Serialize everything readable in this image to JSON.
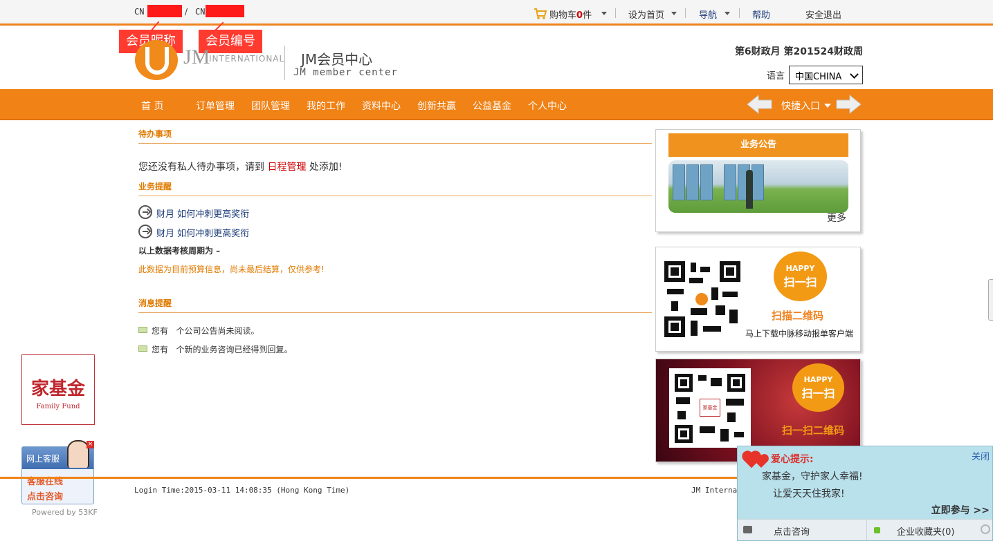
{
  "topbar": {
    "cn_prefix_1": "CN",
    "slash": "/",
    "cn_prefix_2": "CN",
    "cart_label": "购物车",
    "cart_count": "0",
    "cart_unit": "件",
    "set_home": "设为首页",
    "nav": "导航",
    "help": "帮助",
    "logout": "安全退出"
  },
  "annotations": {
    "nickname": "会员昵称",
    "member_no": "会员编号"
  },
  "header": {
    "brand_jm": "JM",
    "brand_intl": "INTERNATIONAL",
    "title": "JM会员中心",
    "subtitle": "JM member center",
    "fiscal": "第6财政月  第201524财政周",
    "lang_label": "语言",
    "lang_value": "中国CHINA"
  },
  "nav": {
    "items": [
      "首  页",
      "订单管理",
      "团队管理",
      "我的工作",
      "资料中心",
      "创新共赢",
      "公益基金",
      "个人中心"
    ],
    "quick": "快捷入口"
  },
  "todo": {
    "title": "待办事项",
    "text_before": "您还没有私人待办事项，请到 ",
    "link": "日程管理",
    "text_after": " 处添加!"
  },
  "business": {
    "title": "业务提醒",
    "items": [
      {
        "label": "财月",
        "link": "如何冲刺更高奖衔"
      },
      {
        "label": "财月",
        "link": "如何冲刺更高奖衔"
      }
    ],
    "period": "以上数据考核周期为   –",
    "note": "此数据为目前预算信息，尚未最后结算，仅供参考!"
  },
  "messages": {
    "title": "消息提醒",
    "items": [
      {
        "prefix": "您有",
        "text": "个公司公告尚未阅读。"
      },
      {
        "prefix": "您有",
        "text": "个新的业务咨询已经得到回复。"
      }
    ]
  },
  "sidebar": {
    "bulletin_title": "业务公告",
    "more": "更多",
    "qr1": {
      "happy": "HAPPY",
      "scan": "扫一扫",
      "caption": "扫描二维码",
      "bottom": "马上下载中脉移动报单客户端"
    },
    "qr2": {
      "happy": "HAPPY",
      "scan": "扫一扫",
      "caption": "扫一扫二维码",
      "logo": "家基金"
    }
  },
  "family_fund": {
    "cn": "家基金",
    "en": "Family Fund"
  },
  "kefu": {
    "head": "网上客服",
    "line1": "客服在线",
    "line2": "点击咨询",
    "close": "×",
    "powered": "Powered by 53KF"
  },
  "footer": {
    "login_time": "Login Time:2015-03-11 14:08:35 (Hong Kong Time)",
    "company": "JM Internat"
  },
  "popup": {
    "close": "关闭",
    "title": "爱心提示:",
    "line1": "家基金，守护家人幸福!",
    "line2": "让爱天天住我家!",
    "join": "立即参与 >>",
    "consult": "点击咨询",
    "favorite": "企业收藏夹(0)"
  },
  "colors": {
    "accent": "#f08216",
    "red": "#cc0000",
    "link": "#1d3c7a"
  }
}
